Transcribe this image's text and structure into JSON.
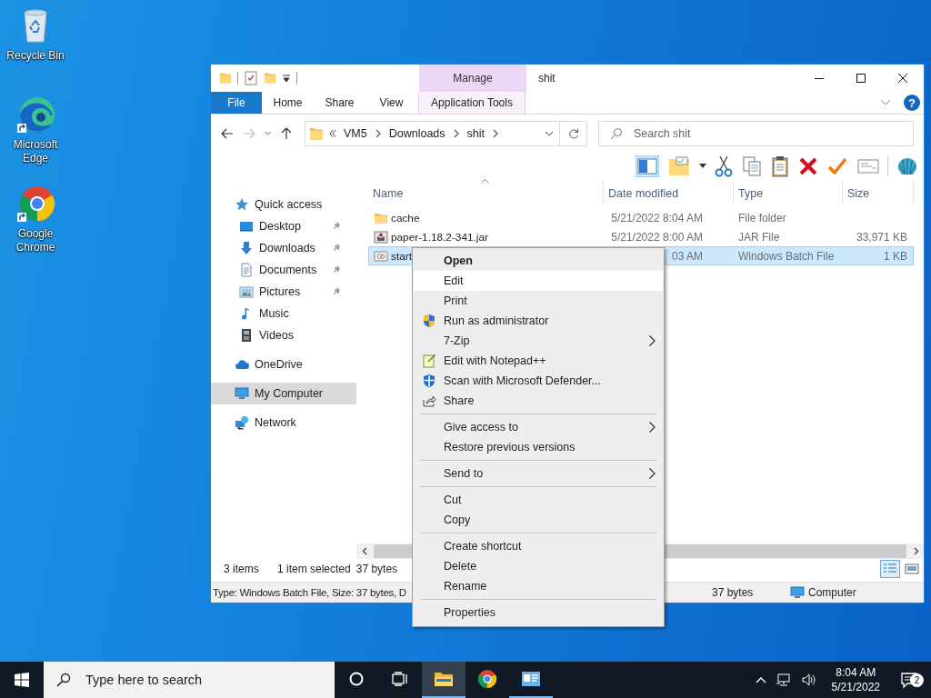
{
  "desktop_icons": [
    {
      "label": "Recycle Bin",
      "kind": "recycle"
    },
    {
      "label": "Microsoft Edge",
      "kind": "edge"
    },
    {
      "label": "Google Chrome",
      "kind": "chrome"
    }
  ],
  "window": {
    "title": "shit",
    "contextual_tab_group": "Manage",
    "ribbon_tabs": [
      {
        "label": "File",
        "kind": "file"
      },
      {
        "label": "Home",
        "kind": "tab"
      },
      {
        "label": "Share",
        "kind": "tab"
      },
      {
        "label": "View",
        "kind": "tab"
      },
      {
        "label": "Application Tools",
        "kind": "contextual"
      }
    ],
    "help_label": "?",
    "address": {
      "breadcrumbs": [
        "VM5",
        "Downloads",
        "shit"
      ]
    },
    "search": {
      "placeholder": "Search shit"
    },
    "navigation": [
      {
        "label": "Quick access",
        "kind": "star",
        "selected": false,
        "children": [
          {
            "label": "Desktop",
            "kind": "desktop",
            "pinned": true,
            "selected": false
          },
          {
            "label": "Downloads",
            "kind": "download",
            "pinned": true,
            "selected": false
          },
          {
            "label": "Documents",
            "kind": "document",
            "pinned": true,
            "selected": false
          },
          {
            "label": "Pictures",
            "kind": "picture",
            "pinned": true,
            "selected": false
          },
          {
            "label": "Music",
            "kind": "music",
            "pinned": false,
            "selected": false
          },
          {
            "label": "Videos",
            "kind": "video",
            "pinned": false,
            "selected": false
          }
        ]
      },
      {
        "label": "OneDrive",
        "kind": "cloud",
        "selected": false
      },
      {
        "label": "My Computer",
        "kind": "computer",
        "selected": true
      },
      {
        "label": "Network",
        "kind": "network",
        "selected": false
      }
    ],
    "columns": [
      "Name",
      "Date modified",
      "Type",
      "Size"
    ],
    "files": [
      {
        "name": "cache",
        "kind": "folder",
        "date_modified": "5/21/2022 8:04 AM",
        "type": "File folder",
        "selected": false
      },
      {
        "name": "paper-1.18.2-341.jar",
        "kind": "jar",
        "date_modified": "5/21/2022 8:00 AM",
        "type": "JAR File",
        "size": "33,971 KB",
        "selected": false
      },
      {
        "name": "start",
        "kind": "batch",
        "date_modified": "03 AM",
        "type": "Windows Batch File",
        "size": "1 KB",
        "selected": true
      }
    ],
    "status_bar": {
      "item_count": "3 items",
      "selection": "1 item selected",
      "selection_size": "37 bytes"
    },
    "details_bar": {
      "description": "Type: Windows Batch File, Size: 37 bytes, D",
      "size": "37 bytes",
      "location": "Computer"
    }
  },
  "context_menu": {
    "groups": [
      [
        {
          "label": "Open",
          "kind": "plain",
          "default": true,
          "highlighted": false,
          "submenu": false
        },
        {
          "label": "Edit",
          "kind": "plain",
          "default": false,
          "highlighted": true,
          "submenu": false
        },
        {
          "label": "Print",
          "kind": "plain",
          "default": false,
          "highlighted": false,
          "submenu": false
        },
        {
          "label": "Run as administrator",
          "kind": "shield",
          "default": false,
          "highlighted": false,
          "submenu": false
        },
        {
          "label": "7-Zip",
          "kind": "plain",
          "default": false,
          "highlighted": false,
          "submenu": true
        },
        {
          "label": "Edit with Notepad++",
          "kind": "notepad",
          "default": false,
          "highlighted": false,
          "submenu": false
        },
        {
          "label": "Scan with Microsoft Defender...",
          "kind": "defender",
          "default": false,
          "highlighted": false,
          "submenu": false
        },
        {
          "label": "Share",
          "kind": "share",
          "default": false,
          "highlighted": false,
          "submenu": false
        }
      ],
      [
        {
          "label": "Give access to",
          "kind": "plain",
          "default": false,
          "highlighted": false,
          "submenu": true
        },
        {
          "label": "Restore previous versions",
          "kind": "plain",
          "default": false,
          "highlighted": false,
          "submenu": false
        }
      ],
      [
        {
          "label": "Send to",
          "kind": "plain",
          "default": false,
          "highlighted": false,
          "submenu": true
        }
      ],
      [
        {
          "label": "Cut",
          "kind": "plain",
          "default": false,
          "highlighted": false,
          "submenu": false
        },
        {
          "label": "Copy",
          "kind": "plain",
          "default": false,
          "highlighted": false,
          "submenu": false
        }
      ],
      [
        {
          "label": "Create shortcut",
          "kind": "plain",
          "default": false,
          "highlighted": false,
          "submenu": false
        },
        {
          "label": "Delete",
          "kind": "plain",
          "default": false,
          "highlighted": false,
          "submenu": false
        },
        {
          "label": "Rename",
          "kind": "plain",
          "default": false,
          "highlighted": false,
          "submenu": false
        }
      ],
      [
        {
          "label": "Properties",
          "kind": "plain",
          "default": false,
          "highlighted": false,
          "submenu": false
        }
      ]
    ]
  },
  "taskbar": {
    "search_placeholder": "Type here to search",
    "apps": [
      {
        "kind": "explorer",
        "selected": true,
        "running": true
      },
      {
        "kind": "chrome",
        "selected": false,
        "running": false
      },
      {
        "kind": "app",
        "selected": false,
        "running": true
      }
    ],
    "clock": {
      "time": "8:04 AM",
      "date": "5/21/2022"
    },
    "notification_count": "2"
  }
}
